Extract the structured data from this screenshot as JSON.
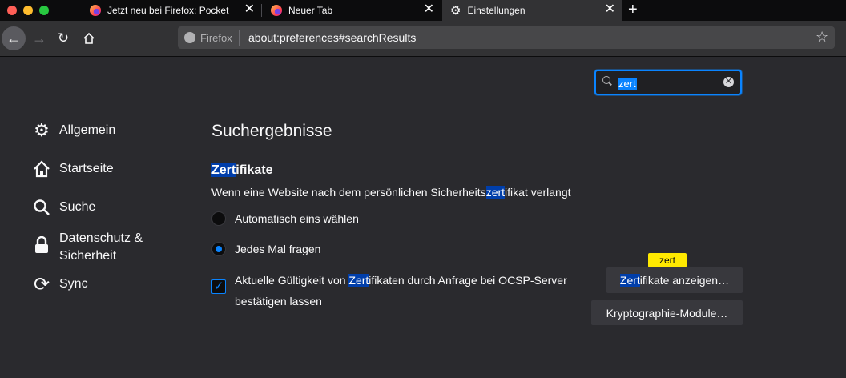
{
  "tabs": [
    {
      "title": "Jetzt neu bei Firefox: Pocket",
      "icon": "firefox-icon"
    },
    {
      "title": "Neuer Tab",
      "icon": "firefox-icon"
    },
    {
      "title": "Einstellungen",
      "icon": "gear-icon"
    }
  ],
  "tab_close_glyph": "✕",
  "new_tab_glyph": "+",
  "urlbar": {
    "identity_label": "Firefox",
    "url": "about:preferences#searchResults"
  },
  "search": {
    "value": "zert",
    "clear_glyph": "✕"
  },
  "sidebar": {
    "items": [
      {
        "label": "Allgemein",
        "icon": "gear-icon"
      },
      {
        "label": "Startseite",
        "icon": "home-icon"
      },
      {
        "label": "Suche",
        "icon": "search-icon"
      },
      {
        "label_line1": "Datenschutz &",
        "label_line2": "Sicherheit",
        "icon": "lock-icon"
      },
      {
        "label": "Sync",
        "icon": "sync-icon"
      }
    ]
  },
  "main": {
    "heading": "Suchergebnisse",
    "section": {
      "title_hl": "Zert",
      "title_rest": "ifikate",
      "desc_before": "Wenn eine Website nach dem persönlichen Sicherheits",
      "desc_hl": "zert",
      "desc_after": "ifikat verlangt",
      "radio_auto": "Automatisch eins wählen",
      "radio_ask": "Jedes Mal fragen",
      "selected_radio": "ask",
      "check_before": "Aktuelle Gültigkeit von ",
      "check_hl": "Zert",
      "check_after": "ifikaten durch Anfrage bei OCSP-Server bestätigen lassen",
      "check_checked": true,
      "tooltip": "zert",
      "btn_certs_hl": "Zert",
      "btn_certs_rest": "ifikate anzeigen…",
      "btn_crypto": "Kryptographie-Module…"
    }
  },
  "colors": {
    "accent": "#0a84ff",
    "highlight": "#003eaa",
    "tooltip": "#ffe900",
    "background": "#2a2a2e"
  }
}
